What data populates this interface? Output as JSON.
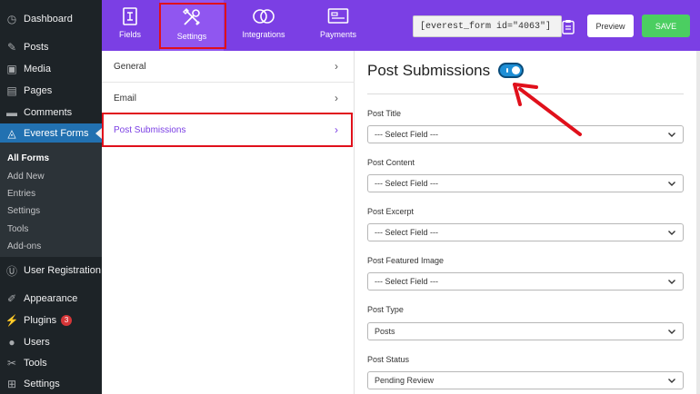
{
  "sidebar": {
    "items": [
      {
        "label": "Dashboard",
        "icon": "dashboard-icon",
        "glyph": "◷"
      },
      {
        "label": "Posts",
        "icon": "pin-icon",
        "glyph": "✎"
      },
      {
        "label": "Media",
        "icon": "media-icon",
        "glyph": "▣"
      },
      {
        "label": "Pages",
        "icon": "pages-icon",
        "glyph": "▤"
      },
      {
        "label": "Comments",
        "icon": "comment-icon",
        "glyph": "▬"
      },
      {
        "label": "Everest Forms",
        "icon": "everest-icon",
        "glyph": "◬"
      },
      {
        "label": "User Registration",
        "icon": "user-registration-icon",
        "glyph": "Ⓤ"
      },
      {
        "label": "Appearance",
        "icon": "brush-icon",
        "glyph": "✐"
      },
      {
        "label": "Plugins",
        "icon": "plugin-icon",
        "glyph": "⚡",
        "badge": "3"
      },
      {
        "label": "Users",
        "icon": "users-icon",
        "glyph": "●"
      },
      {
        "label": "Tools",
        "icon": "wrench-icon",
        "glyph": "✂"
      },
      {
        "label": "Settings",
        "icon": "settings-icon",
        "glyph": "⊞"
      }
    ],
    "submenu": [
      "All Forms",
      "Add New",
      "Entries",
      "Settings",
      "Tools",
      "Add-ons"
    ]
  },
  "builder": {
    "tabs": [
      {
        "label": "Fields",
        "icon": "fields-icon"
      },
      {
        "label": "Settings",
        "icon": "settings-tools-icon"
      },
      {
        "label": "Integrations",
        "icon": "integrations-icon"
      },
      {
        "label": "Payments",
        "icon": "payments-icon"
      }
    ],
    "shortcode": "[everest_form id=\"4063\"]",
    "preview_label": "Preview",
    "save_label": "SAVE"
  },
  "settings_menu": {
    "items": [
      "General",
      "Email",
      "Post Submissions"
    ]
  },
  "content": {
    "title": "Post Submissions",
    "toggle_on": true,
    "fields": [
      {
        "label": "Post Title",
        "value": "--- Select Field ---"
      },
      {
        "label": "Post Content",
        "value": "--- Select Field ---"
      },
      {
        "label": "Post Excerpt",
        "value": "--- Select Field ---"
      },
      {
        "label": "Post Featured Image",
        "value": "--- Select Field ---"
      },
      {
        "label": "Post Type",
        "value": "Posts"
      },
      {
        "label": "Post Status",
        "value": "Pending Review"
      }
    ]
  },
  "colors": {
    "brand": "#7b3fe4",
    "wp_sidebar": "#1d2327",
    "wp_active": "#2271b1",
    "save": "#4bce61",
    "toggle": "#1e8fd6",
    "highlight": "#e0101b"
  }
}
